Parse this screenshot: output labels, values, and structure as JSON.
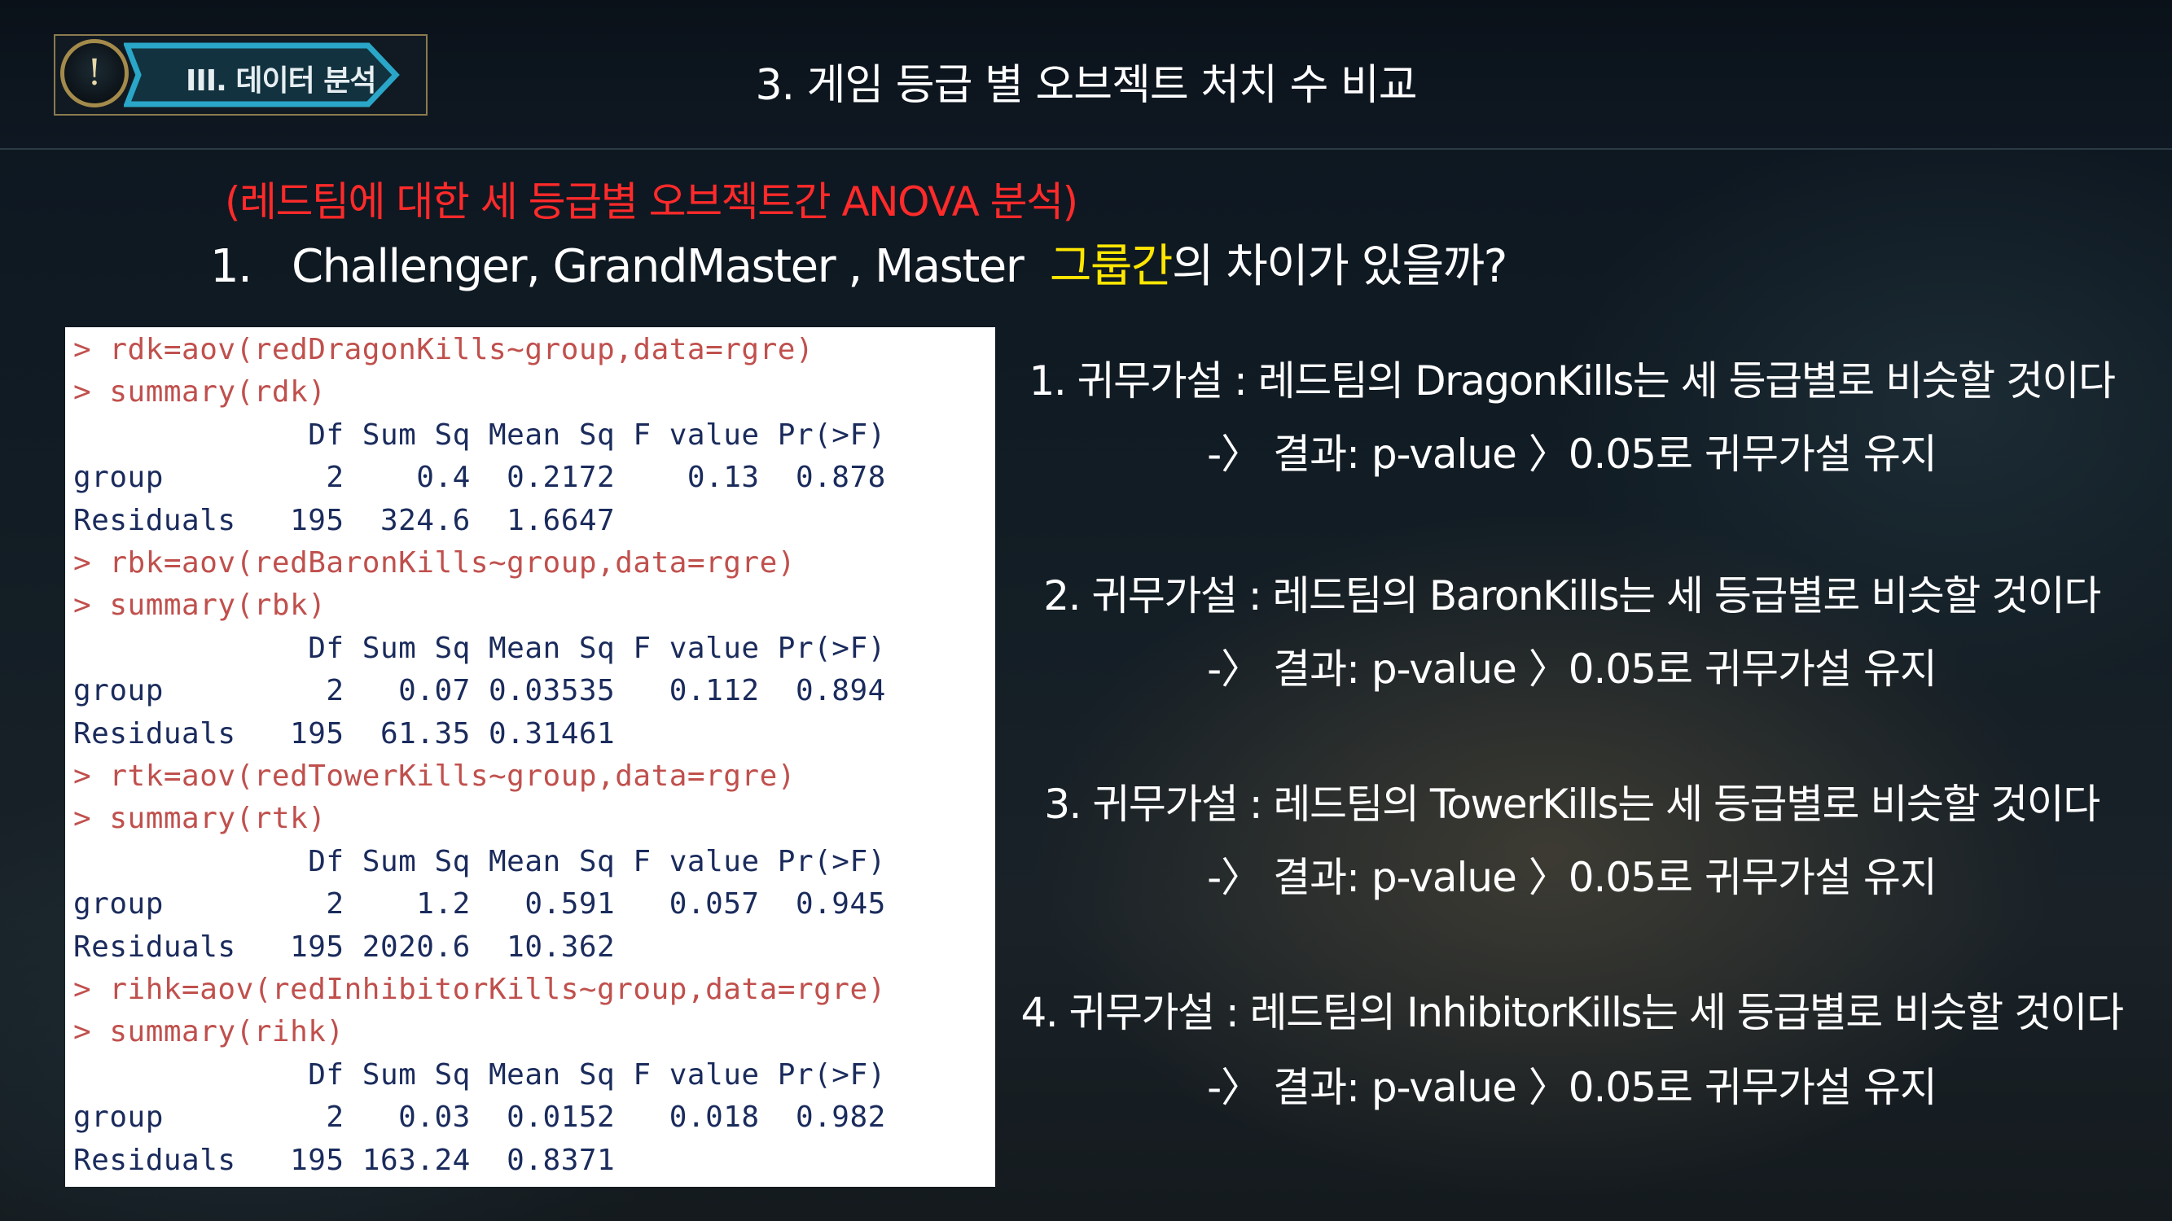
{
  "header": {
    "badge_icon": "exclamation-icon",
    "badge_label": "III. 데이터 분석",
    "title": "3. 게임 등급 별 오브젝트 처치 수 비교"
  },
  "subtitle": "(레드팀에 대한 세 등급별 오브젝트간 ANOVA 분석)",
  "question": {
    "number": "1.",
    "prefix": "Challenger, GrandMaster , Master",
    "highlight": "그룹간",
    "suffix": "의 차이가 있을까?"
  },
  "code_lines": [
    {
      "kind": "cmd",
      "text": "> rdk=aov(redDragonKills~group,data=rgre)"
    },
    {
      "kind": "cmd",
      "text": "> summary(rdk)"
    },
    {
      "kind": "out",
      "text": "             Df Sum Sq Mean Sq F value Pr(>F)"
    },
    {
      "kind": "out",
      "text": "group         2    0.4  0.2172    0.13  0.878"
    },
    {
      "kind": "out",
      "text": "Residuals   195  324.6  1.6647"
    },
    {
      "kind": "cmd",
      "text": "> rbk=aov(redBaronKills~group,data=rgre)"
    },
    {
      "kind": "cmd",
      "text": "> summary(rbk)"
    },
    {
      "kind": "out",
      "text": "             Df Sum Sq Mean Sq F value Pr(>F)"
    },
    {
      "kind": "out",
      "text": "group         2   0.07 0.03535   0.112  0.894"
    },
    {
      "kind": "out",
      "text": "Residuals   195  61.35 0.31461"
    },
    {
      "kind": "cmd",
      "text": "> rtk=aov(redTowerKills~group,data=rgre)"
    },
    {
      "kind": "cmd",
      "text": "> summary(rtk)"
    },
    {
      "kind": "out",
      "text": "             Df Sum Sq Mean Sq F value Pr(>F)"
    },
    {
      "kind": "out",
      "text": "group         2    1.2   0.591   0.057  0.945"
    },
    {
      "kind": "out",
      "text": "Residuals   195 2020.6  10.362"
    },
    {
      "kind": "cmd",
      "text": "> rihk=aov(redInhibitorKills~group,data=rgre)"
    },
    {
      "kind": "cmd",
      "text": "> summary(rihk)"
    },
    {
      "kind": "out",
      "text": "             Df Sum Sq Mean Sq F value Pr(>F)"
    },
    {
      "kind": "out",
      "text": "group         2   0.03  0.0152   0.018  0.982"
    },
    {
      "kind": "out",
      "text": "Residuals   195 163.24  0.8371"
    }
  ],
  "hypotheses": [
    {
      "statement": "1. 귀무가설 : 레드팀의 DragonKills는 세 등급별로 비슷할 것이다",
      "result": "-〉 결과: p-value 〉0.05로 귀무가설 유지"
    },
    {
      "statement": "2. 귀무가설 : 레드팀의 BaronKills는 세 등급별로 비슷할 것이다",
      "result": "-〉 결과: p-value 〉0.05로 귀무가설 유지"
    },
    {
      "statement": "3. 귀무가설 : 레드팀의 TowerKills는 세 등급별로 비슷할 것이다",
      "result": "-〉 결과: p-value 〉0.05로 귀무가설 유지"
    },
    {
      "statement": "4. 귀무가설 : 레드팀의 InhibitorKills는 세 등급별로 비슷할 것이다",
      "result": "-〉 결과: p-value 〉0.05로 귀무가설 유지"
    }
  ],
  "colors": {
    "subtitle": "#ff2a2a",
    "highlight": "#ffe600",
    "code_command": "#c0504d",
    "code_output": "#1a2b5c",
    "badge_accent": "#2aa6c8"
  }
}
